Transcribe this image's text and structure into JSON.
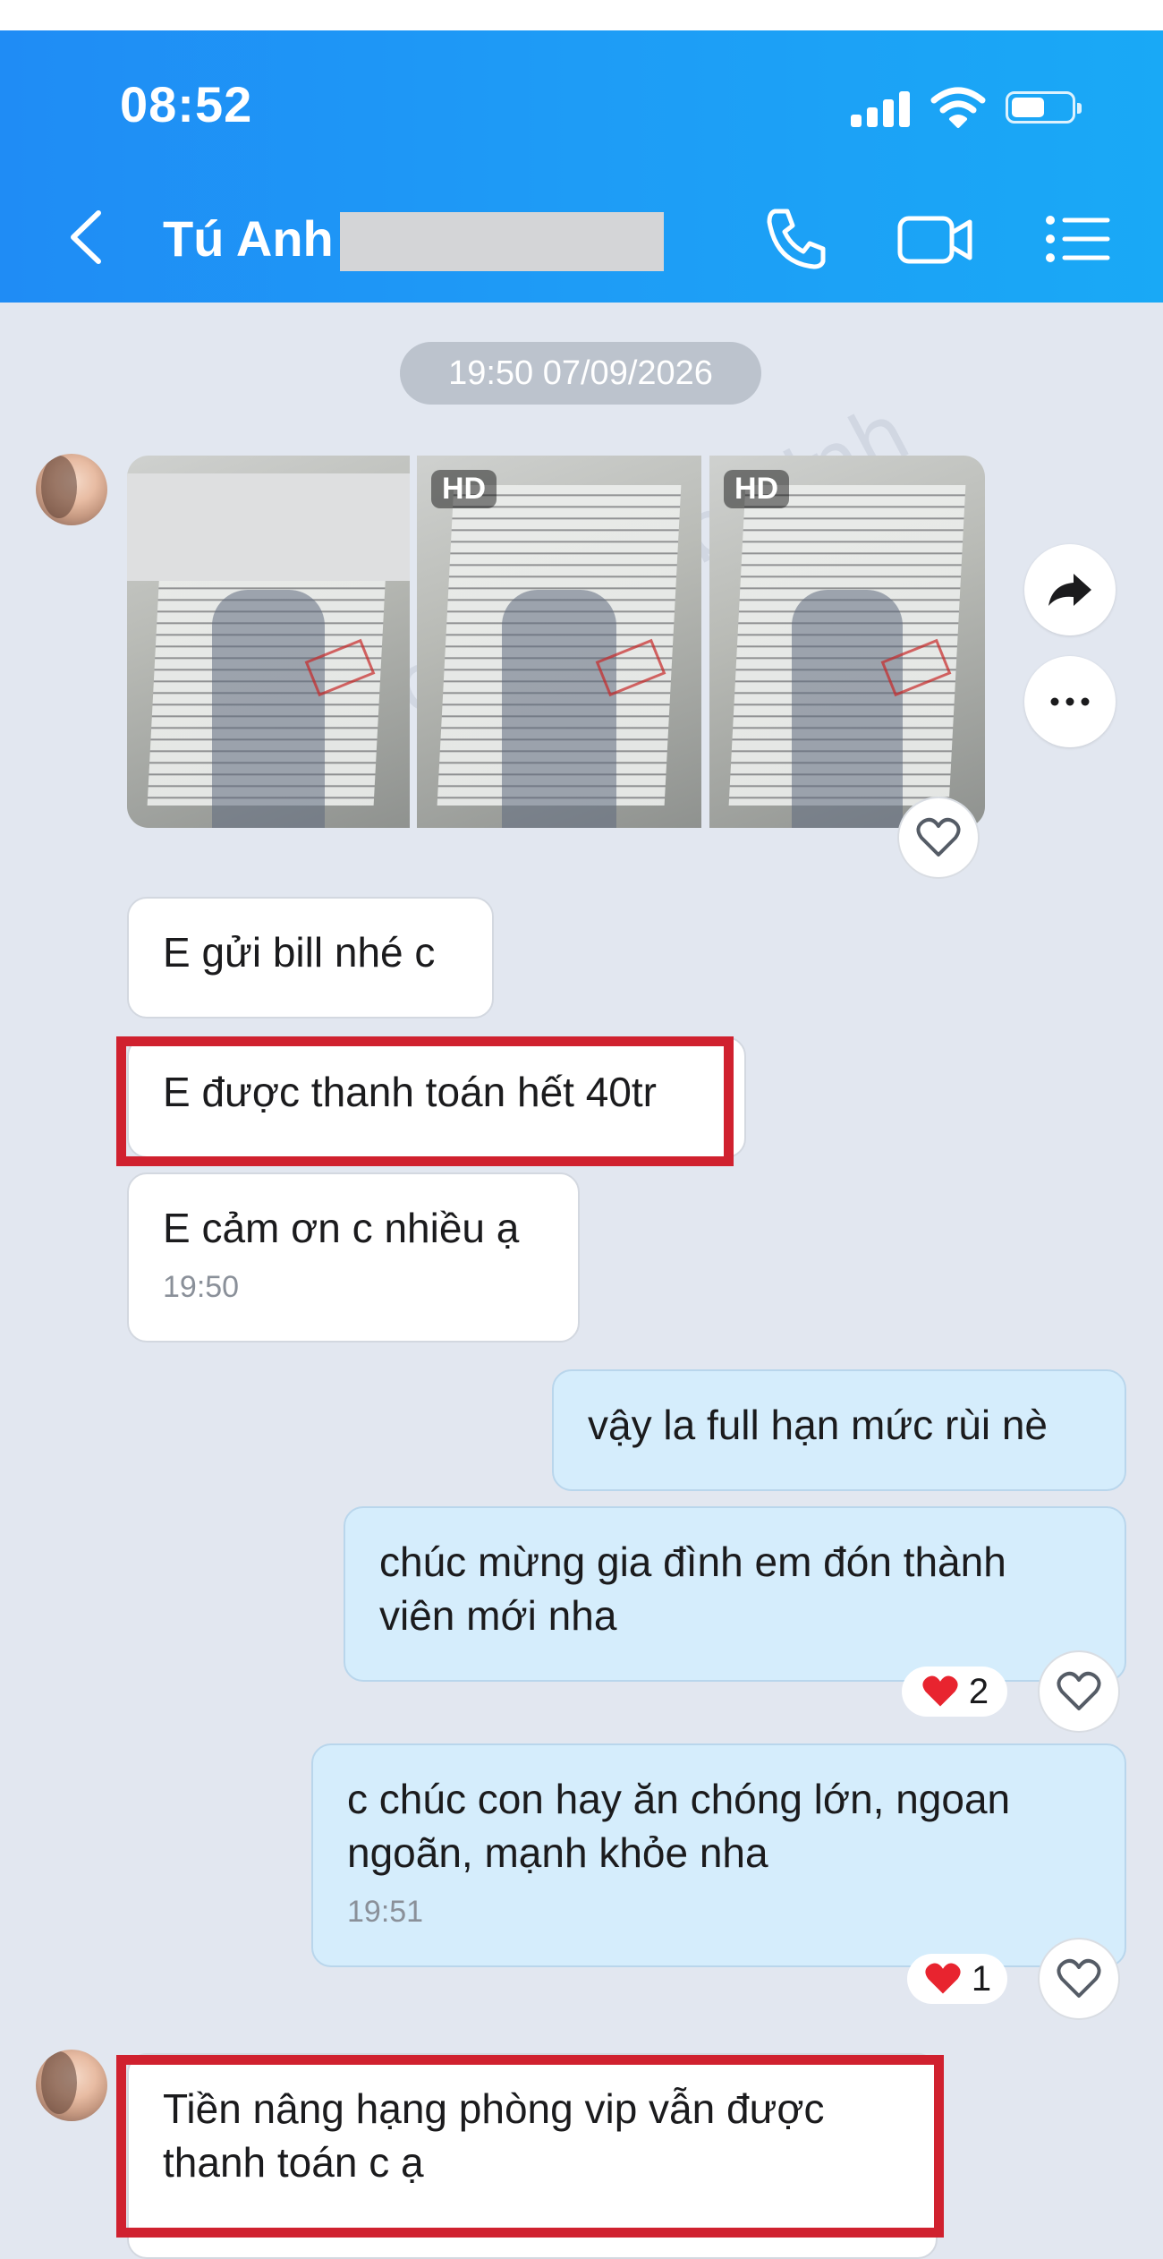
{
  "status_bar": {
    "time": "08:52"
  },
  "header": {
    "contact_name": "Tú Anh",
    "icons": [
      "back-chevron-icon",
      "phone-icon",
      "video-camera-icon",
      "menu-list-icon"
    ]
  },
  "chat": {
    "date_separator": "19:50 07/09/2026",
    "photos": [
      {
        "badge": ""
      },
      {
        "badge": "HD"
      },
      {
        "badge": "HD"
      }
    ],
    "messages": [
      {
        "text": "E gửi bill nhé c"
      },
      {
        "text": "E được thanh toán hết 40tr"
      },
      {
        "text": "E cảm ơn c nhiều ạ",
        "time": "19:50"
      },
      {
        "text": "vậy la full hạn mức rùi nè"
      },
      {
        "text": "chúc mừng gia đình em đón thành viên mới nha",
        "reaction_count": "2"
      },
      {
        "text": "c chúc con hay ăn chóng lớn, ngoan ngoãn, mạnh khỏe nha",
        "time": "19:51",
        "reaction_count": "1"
      },
      {
        "text": "Tiền nâng hạng phòng vip vẫn được thanh toán c ạ"
      }
    ]
  },
  "colors": {
    "header_blue": "#1f8cf5",
    "chat_bg": "#e2e7f0",
    "outgoing_bubble": "#d5edfc",
    "highlight_red": "#d0212f",
    "heart_red": "#e8242f"
  }
}
